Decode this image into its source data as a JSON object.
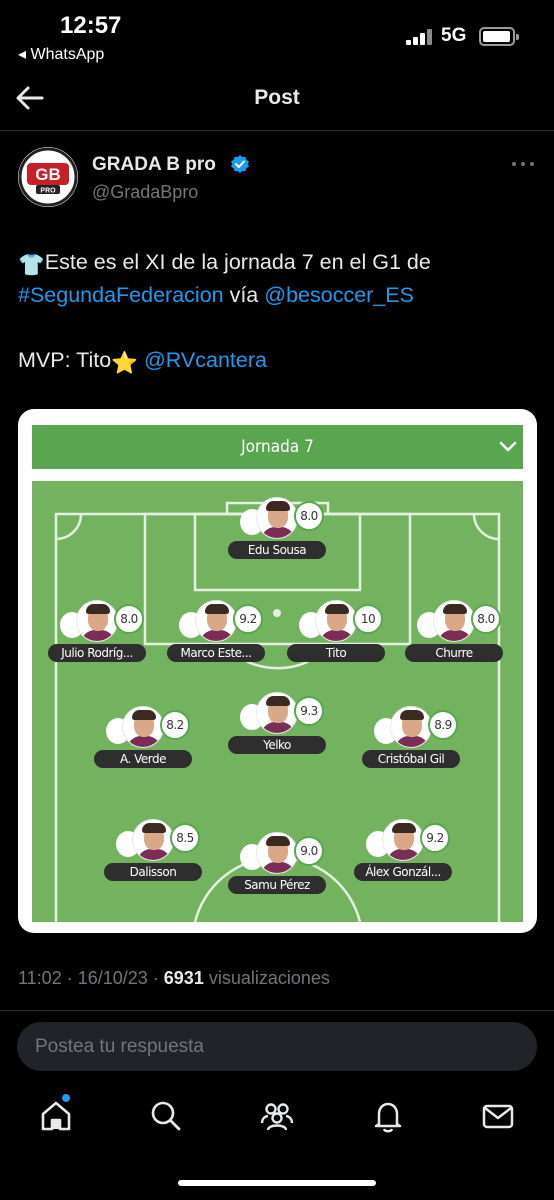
{
  "status_bar": {
    "time": "12:57",
    "back_app": "◂ WhatsApp",
    "network": "5G"
  },
  "header": {
    "title": "Post",
    "back_icon": "arrow-left-icon"
  },
  "author": {
    "name": "GRADA B pro",
    "handle": "@GradaBpro",
    "avatar_text": "GB",
    "avatar_subtext": "PRO",
    "verified_icon": "verified-badge-icon"
  },
  "tweet": {
    "line1_emoji": "👕",
    "line1_text": "Este es el XI de la jornada 7 en el G1 de",
    "line2_hashtag": "#SegundaFederacion",
    "line2_via": " vía ",
    "line2_mention": "@besoccer_ES",
    "line3_text": "MVP: Tito",
    "line3_emoji": "⭐️",
    "line3_mention": "@RVcantera"
  },
  "card": {
    "jornada_label": "Jornada 7",
    "players": [
      {
        "name": "Edu Sousa",
        "rating": "8.0"
      },
      {
        "name": "Julio Rodríg...",
        "rating": "8.0"
      },
      {
        "name": "Marco Este...",
        "rating": "9.2"
      },
      {
        "name": "Tito",
        "rating": "10"
      },
      {
        "name": "Churre",
        "rating": "8.0"
      },
      {
        "name": "A. Verde",
        "rating": "8.2"
      },
      {
        "name": "Yelko",
        "rating": "9.3"
      },
      {
        "name": "Cristóbal Gil",
        "rating": "8.9"
      },
      {
        "name": "Dalisson",
        "rating": "8.5"
      },
      {
        "name": "Samu Pérez",
        "rating": "9.0"
      },
      {
        "name": "Álex Gonzál...",
        "rating": "9.2"
      }
    ]
  },
  "meta": {
    "time": "11:02 · 16/10/23 · ",
    "views": "6931",
    "views_label": " visualizaciones"
  },
  "reply": {
    "placeholder": "Postea tu respuesta"
  },
  "nav": {
    "items": [
      "home-icon",
      "search-icon",
      "communities-icon",
      "notifications-icon",
      "messages-icon"
    ]
  },
  "colors": {
    "accent": "#1d9bf0",
    "pitch": "#73b25f",
    "bar": "#5aa650"
  }
}
